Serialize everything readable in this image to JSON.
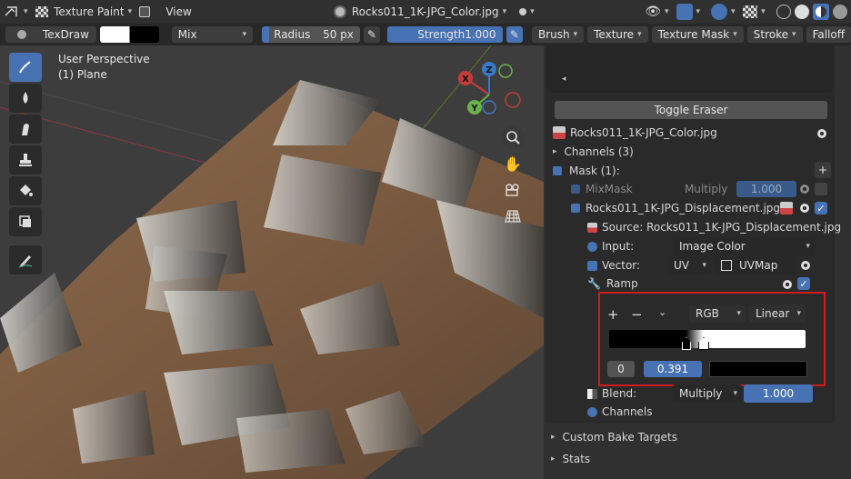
{
  "header": {
    "mode_label": "Texture Paint",
    "view_menu": "View",
    "image_name": "Rocks011_1K-JPG_Color.jpg"
  },
  "tool_settings": {
    "brush_name": "TexDraw",
    "blend_mode": "Mix",
    "radius_label": "Radius",
    "radius_value": "50 px",
    "strength_label": "Strength",
    "strength_value": "1.000",
    "menus": [
      "Brush",
      "Texture",
      "Texture Mask",
      "Stroke",
      "Falloff"
    ]
  },
  "viewport": {
    "perspective_label": "User Perspective",
    "object_label": "(1) Plane",
    "gizmo_x": "X",
    "gizmo_y": "Y",
    "gizmo_z": "Z"
  },
  "panel": {
    "toggle_eraser": "Toggle Eraser",
    "image_item": "Rocks011_1K-JPG_Color.jpg",
    "channels_item": "Channels (3)",
    "mask_item": "Mask (1):",
    "mixmask": {
      "label": "MixMask",
      "blend": "Multiply",
      "value": "1.000"
    },
    "displacement": {
      "label": "Rocks011_1K-JPG_Displacement.jpg",
      "source": "Source: Rocks011_1K-JPG_Displacement.jpg",
      "input_label": "Input:",
      "input_value": "Image Color",
      "vector_label": "Vector:",
      "vector_mode": "UV",
      "vector_map": "UVMap",
      "ramp_label": "Ramp"
    },
    "ramp": {
      "add": "+",
      "remove": "−",
      "color_mode": "RGB",
      "interpolation": "Linear",
      "index": "0",
      "position": "0.391"
    },
    "blend": {
      "label": "Blend:",
      "mode": "Multiply",
      "value": "1.000"
    },
    "channels_sub": "Channels",
    "custom_bake": "Custom Bake Targets",
    "stats": "Stats"
  },
  "colors": {
    "accent": "#4772b3",
    "highlight_box": "#d01c1c"
  }
}
